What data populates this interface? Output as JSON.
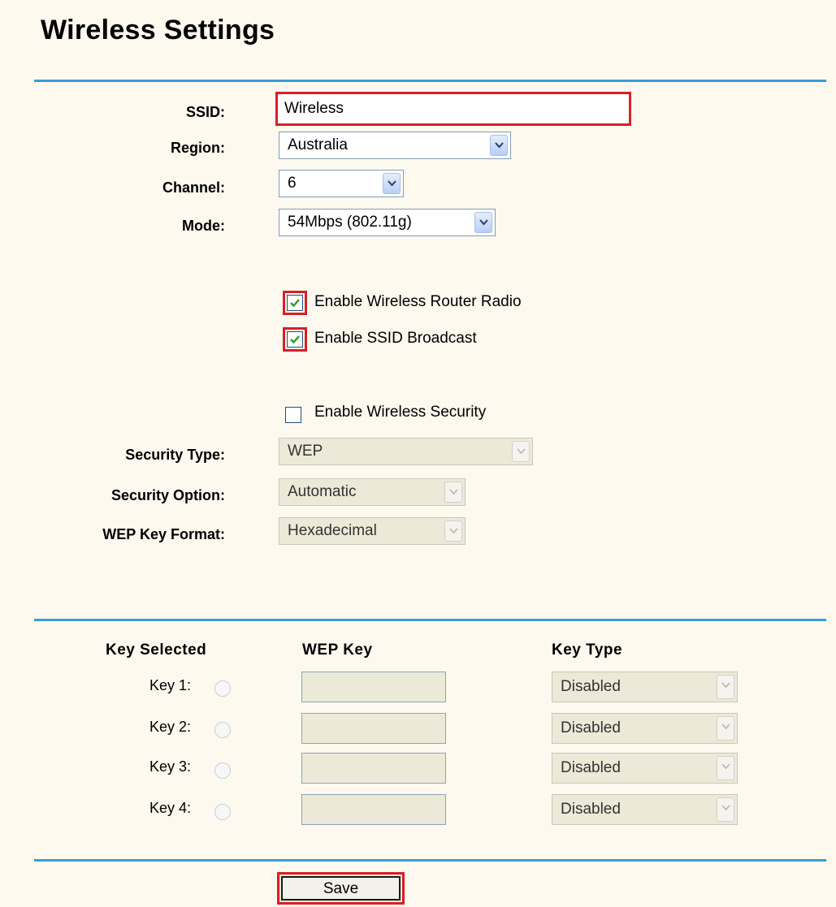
{
  "page": {
    "title": "Wireless Settings"
  },
  "basic": {
    "ssid_label": "SSID:",
    "ssid_value": "Wireless",
    "region_label": "Region:",
    "region_value": "Australia",
    "channel_label": "Channel:",
    "channel_value": "6",
    "mode_label": "Mode:",
    "mode_value": "54Mbps (802.11g)"
  },
  "options": {
    "enable_radio": {
      "label": "Enable Wireless Router Radio",
      "checked": true
    },
    "enable_ssid_broadcast": {
      "label": "Enable SSID Broadcast",
      "checked": true
    }
  },
  "security": {
    "enable_security": {
      "label": "Enable Wireless Security",
      "checked": false
    },
    "type_label": "Security Type:",
    "type_value": "WEP",
    "option_label": "Security Option:",
    "option_value": "Automatic",
    "format_label": "WEP Key Format:",
    "format_value": "Hexadecimal"
  },
  "keys": {
    "headers": {
      "selected": "Key Selected",
      "wep_key": "WEP Key",
      "key_type": "Key Type"
    },
    "rows": [
      {
        "label": "Key 1:",
        "key": "",
        "type": "Disabled"
      },
      {
        "label": "Key 2:",
        "key": "",
        "type": "Disabled"
      },
      {
        "label": "Key 3:",
        "key": "",
        "type": "Disabled"
      },
      {
        "label": "Key 4:",
        "key": "",
        "type": "Disabled"
      }
    ]
  },
  "actions": {
    "save_label": "Save"
  },
  "colors": {
    "divider": "#3a9bd6",
    "highlight": "#d81f26",
    "check": "#21a121"
  }
}
